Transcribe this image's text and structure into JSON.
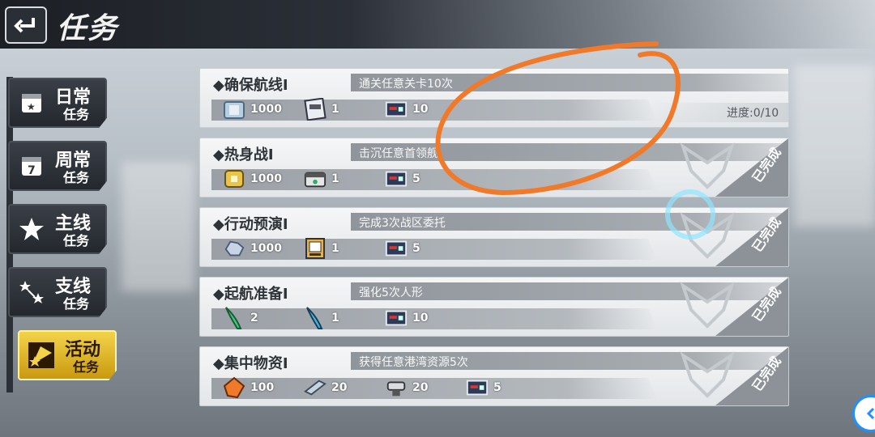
{
  "header": {
    "title": "任务",
    "back_icon": "back-arrow-icon"
  },
  "sidebar": {
    "items": [
      {
        "line1": "日常",
        "line2": "任务",
        "icon": "calendar-star-icon",
        "active": false
      },
      {
        "line1": "周常",
        "line2": "任务",
        "icon": "calendar-7-icon",
        "active": false
      },
      {
        "line1": "主线",
        "line2": "任务",
        "icon": "star-icon",
        "active": false
      },
      {
        "line1": "支线",
        "line2": "任务",
        "icon": "star-branch-icon",
        "active": false
      },
      {
        "line1": "活动",
        "line2": "任务",
        "icon": "flag-star-icon",
        "active": true
      }
    ]
  },
  "tasks": [
    {
      "name": "◆确保航线I",
      "desc": "通关任意关卡10次",
      "rewards": [
        {
          "icon": "supply-box-icon",
          "qty": "1000"
        },
        {
          "icon": "ship-card-icon",
          "qty": "1"
        },
        {
          "icon": "ticket-icon",
          "qty": "10"
        }
      ],
      "progress": "进度:0/10",
      "completed": false
    },
    {
      "name": "◆热身战I",
      "desc": "击沉任意首领舰",
      "rewards": [
        {
          "icon": "gold-crate-icon",
          "qty": "1000"
        },
        {
          "icon": "white-crate-icon",
          "qty": "1"
        },
        {
          "icon": "ticket-icon",
          "qty": "5"
        }
      ],
      "progress": "",
      "completed": true,
      "completed_label": "已完成"
    },
    {
      "name": "◆行动预演I",
      "desc": "完成3次战区委托",
      "rewards": [
        {
          "icon": "ore-icon",
          "qty": "1000"
        },
        {
          "icon": "blueprint-icon",
          "qty": "1"
        },
        {
          "icon": "ticket-icon",
          "qty": "5"
        }
      ],
      "progress": "",
      "completed": true,
      "completed_label": "已完成"
    },
    {
      "name": "◆起航准备I",
      "desc": "强化5次人形",
      "rewards": [
        {
          "icon": "green-feather-icon",
          "qty": "2"
        },
        {
          "icon": "blue-feather-icon",
          "qty": "1"
        },
        {
          "icon": "ticket-icon",
          "qty": "10"
        }
      ],
      "progress": "",
      "completed": true,
      "completed_label": "已完成"
    },
    {
      "name": "◆集中物资I",
      "desc": "获得任意港湾资源5次",
      "rewards": [
        {
          "icon": "amber-gem-icon",
          "qty": "100"
        },
        {
          "icon": "steel-beam-icon",
          "qty": "20"
        },
        {
          "icon": "anvil-icon",
          "qty": "20"
        },
        {
          "icon": "ticket-icon",
          "qty": "5"
        }
      ],
      "progress": "",
      "completed": true,
      "completed_label": "已完成"
    }
  ],
  "colors": {
    "accent_gold": "#f3d34a",
    "annotation": "#f07a2a",
    "side_button": "#1e90ff"
  }
}
